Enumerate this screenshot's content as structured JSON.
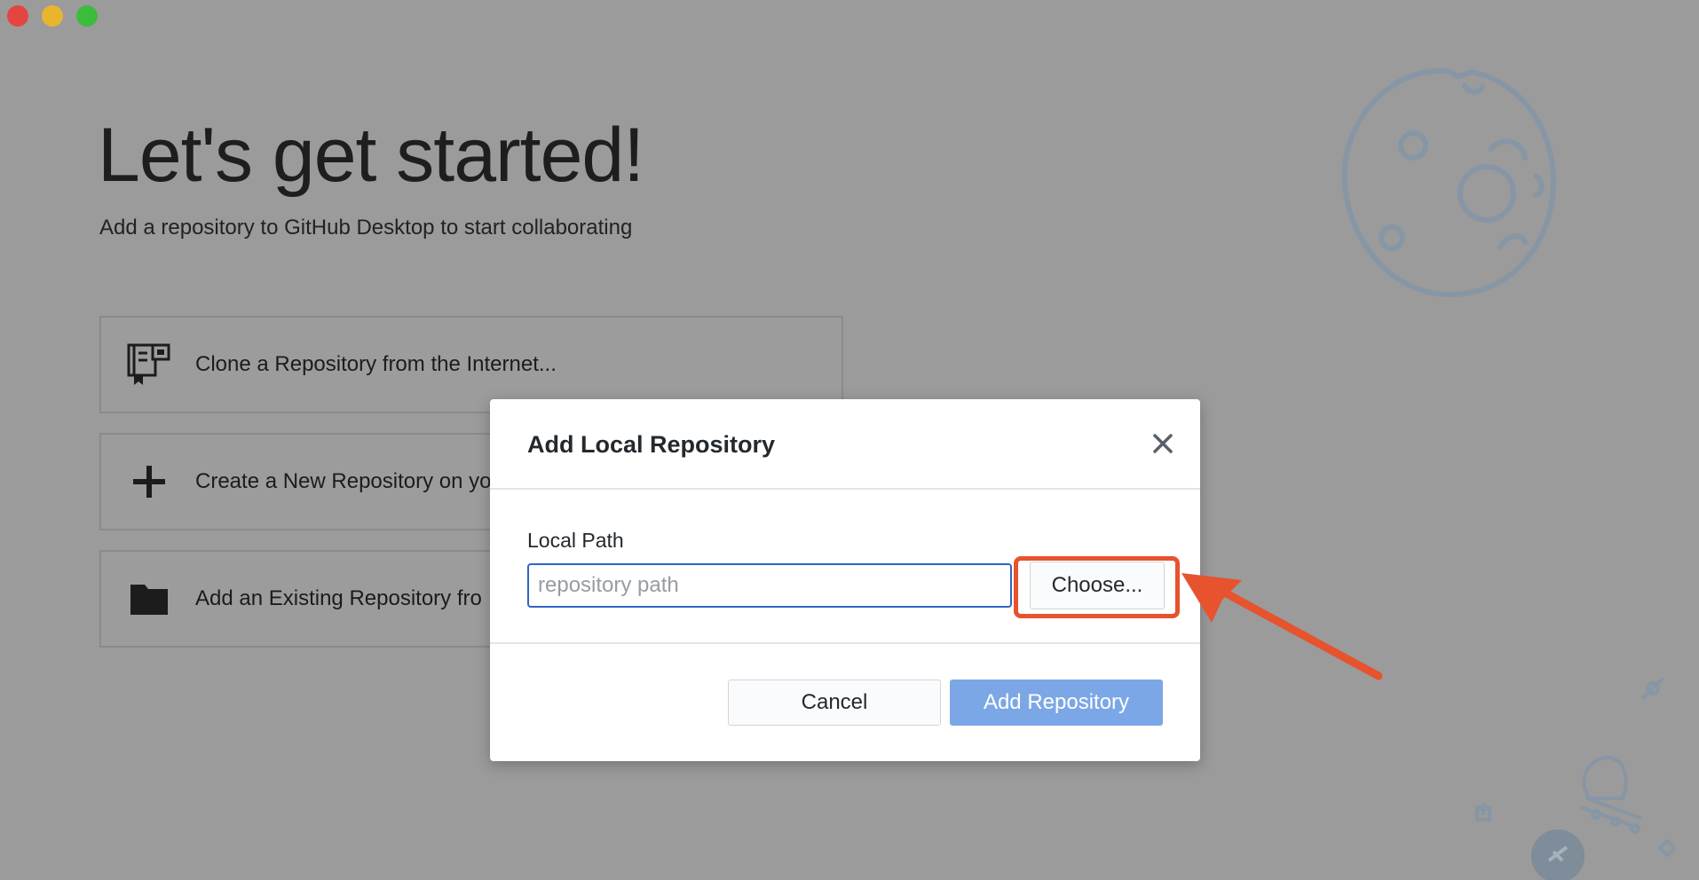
{
  "window": {
    "controls": [
      "close",
      "minimize",
      "maximize"
    ]
  },
  "welcome": {
    "title": "Let's get started!",
    "subtitle": "Add a repository to GitHub Desktop to start collaborating",
    "options": [
      {
        "label": "Clone a Repository from the Internet...",
        "icon": "clone-repo-icon"
      },
      {
        "label": "Create a New Repository on yo",
        "icon": "plus-icon"
      },
      {
        "label": "Add an Existing Repository fro",
        "icon": "folder-icon"
      }
    ]
  },
  "dialog": {
    "title": "Add Local Repository",
    "close_icon": "close-icon",
    "local_path_label": "Local Path",
    "path_value": "",
    "path_placeholder": "repository path",
    "choose_label": "Choose...",
    "cancel_label": "Cancel",
    "add_label": "Add Repository"
  },
  "colors": {
    "overlay_background": "#9b9b9b",
    "primary_button": "#7ca7e6",
    "highlight": "#e6532e"
  }
}
